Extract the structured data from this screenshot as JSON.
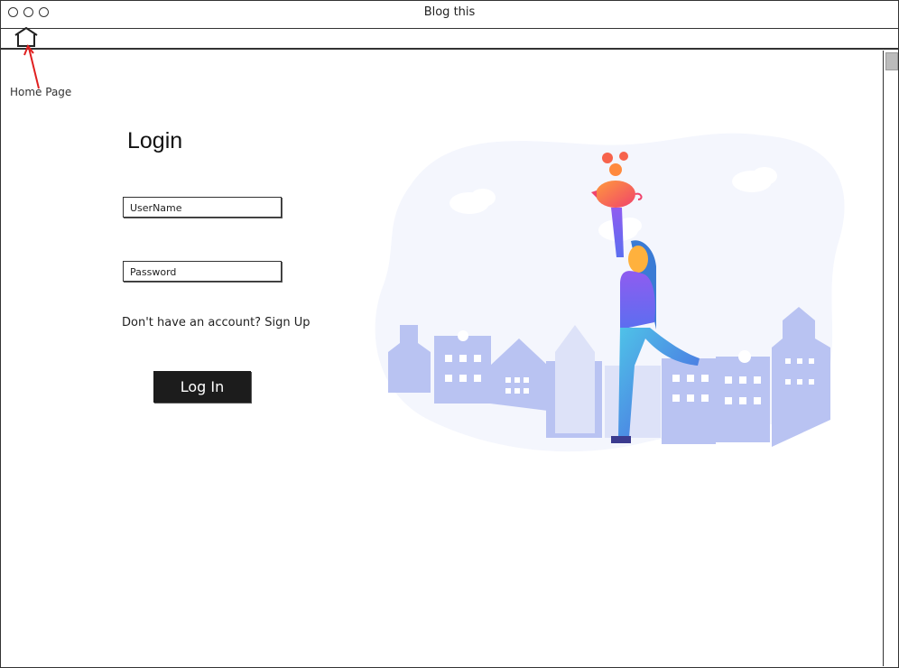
{
  "window": {
    "title": "Blog this"
  },
  "annotation": {
    "home_label": "Home Page"
  },
  "login": {
    "title": "Login",
    "username_placeholder": "UserName",
    "password_placeholder": "Password",
    "signup_prompt": "Don't have an account?",
    "signup_link": "Sign Up",
    "button_label": "Log In"
  },
  "icons": {
    "home": "home-icon",
    "window_controls": [
      "circle-icon",
      "circle-icon",
      "circle-icon"
    ]
  },
  "colors": {
    "accent_red": "#e02020",
    "button_bg": "#1c1c1c",
    "city_blue": "#b9c3f2",
    "blob_bg": "#f4f6fd"
  }
}
